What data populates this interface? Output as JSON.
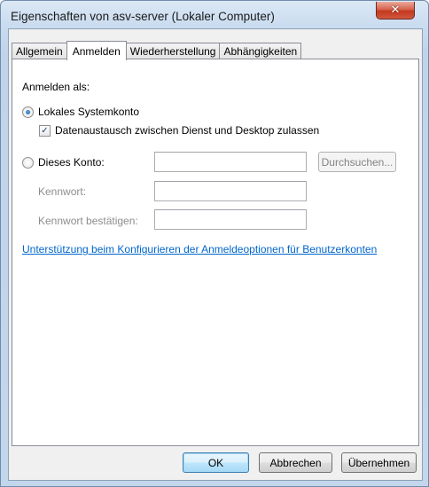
{
  "window": {
    "title": "Eigenschaften von asv-server (Lokaler Computer)",
    "close_symbol": "✕"
  },
  "tabs": [
    {
      "label": "Allgemein",
      "active": false
    },
    {
      "label": "Anmelden",
      "active": true
    },
    {
      "label": "Wiederherstellung",
      "active": false
    },
    {
      "label": "Abhängigkeiten",
      "active": false
    }
  ],
  "logon": {
    "heading": "Anmelden als:",
    "local_system": {
      "label": "Lokales Systemkonto",
      "checked": true
    },
    "desktop_interact": {
      "label": "Datenaustausch zwischen Dienst und Desktop zulassen",
      "checked": true,
      "mark": "✓"
    },
    "this_account": {
      "label": "Dieses Konto:",
      "checked": false,
      "value": ""
    },
    "browse_button": "Durchsuchen...",
    "password": {
      "label": "Kennwort:",
      "value": ""
    },
    "confirm_password": {
      "label": "Kennwort bestätigen:",
      "value": ""
    },
    "help_link": "Unterstützung beim Konfigurieren der Anmeldeoptionen für Benutzerkonten"
  },
  "buttons": {
    "ok": "OK",
    "cancel": "Abbrechen",
    "apply": "Übernehmen"
  },
  "colors": {
    "titlebar": "#c9dbef",
    "dialog_bg": "#f0f0f0",
    "link": "#0066cc",
    "close_button": "#c4381f"
  }
}
